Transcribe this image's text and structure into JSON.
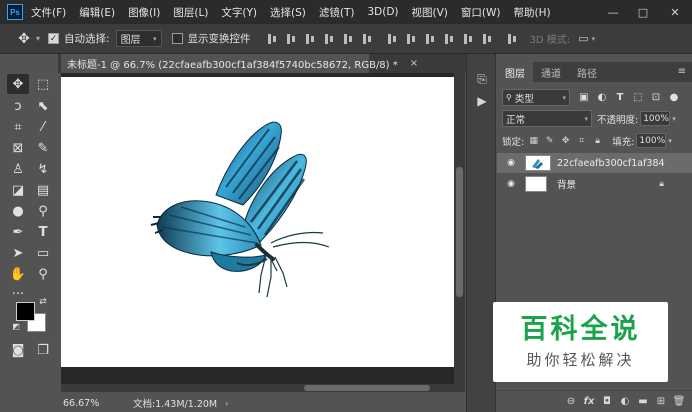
{
  "app": {
    "logo": "Ps",
    "accent": "#31a8ff"
  },
  "menu": [
    "文件(F)",
    "编辑(E)",
    "图像(I)",
    "图层(L)",
    "文字(Y)",
    "选择(S)",
    "滤镜(T)",
    "3D(D)",
    "视图(V)",
    "窗口(W)",
    "帮助(H)"
  ],
  "window_controls": {
    "minimize": "—",
    "maximize": "□",
    "close": "✕"
  },
  "options_bar": {
    "auto_select_label": "自动选择:",
    "auto_select_checked": true,
    "auto_select_target": "图层",
    "show_transform_label": "显示变换控件",
    "show_transform_checked": false,
    "mode_3d_label": "3D 模式:"
  },
  "document": {
    "tab_title": "未标题-1 @ 66.7% (22cfaeafb300cf1af384f5740bc58672, RGB/8) *",
    "close_symbol": "×",
    "zoom": "66.67%",
    "doc_size": "文档:1.43M/1.20M"
  },
  "layers_panel": {
    "tabs": [
      "图层",
      "通道",
      "路径"
    ],
    "active_tab": 0,
    "filter_type": "类型",
    "blend_mode": "正常",
    "opacity_label": "不透明度:",
    "opacity_value": "100%",
    "lock_label": "锁定:",
    "fill_label": "填充:",
    "fill_value": "100%",
    "layers": [
      {
        "name": "22cfaeafb300cf1af384f57...",
        "selected": true,
        "visible": true,
        "locked": false
      },
      {
        "name": "背景",
        "selected": false,
        "visible": true,
        "locked": true
      }
    ],
    "footer_icons": [
      "link-icon",
      "fx-icon",
      "mask-icon",
      "adjustment-icon",
      "folder-icon",
      "new-layer-icon",
      "trash-icon"
    ]
  },
  "watermark": {
    "title": "百科全说",
    "subtitle": "助你轻松解决",
    "color": "#1aa34a"
  }
}
